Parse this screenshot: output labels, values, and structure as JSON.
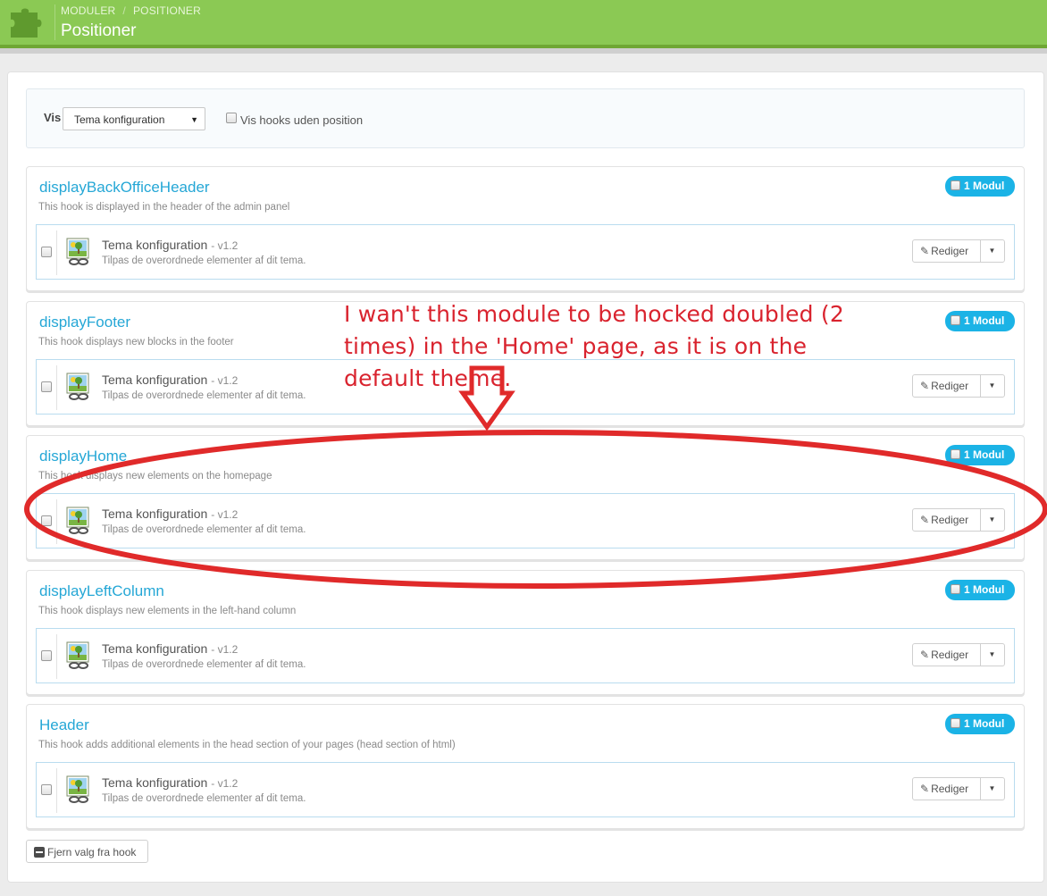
{
  "header": {
    "breadcrumb": [
      "MODULER",
      "POSITIONER"
    ],
    "title": "Positioner",
    "colors": {
      "bar": "#8bc954",
      "accent_line": "#6fa734"
    },
    "icon": "puzzle-piece-icon"
  },
  "filter": {
    "label": "Vis",
    "select_value": "Tema konfiguration",
    "checkbox_label": "Vis hooks uden position"
  },
  "hooks": [
    {
      "name": "displayBackOfficeHeader",
      "description": "This hook is displayed in the header of the admin panel",
      "badge": "1 Modul",
      "module": {
        "name": "Tema konfiguration",
        "version": "- v1.2",
        "description": "Tilpas de overordnede elementer af dit tema.",
        "edit_label": "Rediger"
      }
    },
    {
      "name": "displayFooter",
      "description": "This hook displays new blocks in the footer",
      "badge": "1 Modul",
      "module": {
        "name": "Tema konfiguration",
        "version": "- v1.2",
        "description": "Tilpas de overordnede elementer af dit tema.",
        "edit_label": "Rediger"
      }
    },
    {
      "name": "displayHome",
      "description": "This hook displays new elements on the homepage",
      "badge": "1 Modul",
      "module": {
        "name": "Tema konfiguration",
        "version": "- v1.2",
        "description": "Tilpas de overordnede elementer af dit tema.",
        "edit_label": "Rediger"
      }
    },
    {
      "name": "displayLeftColumn",
      "description": "This hook displays new elements in the left-hand column",
      "badge": "1 Modul",
      "module": {
        "name": "Tema konfiguration",
        "version": "- v1.2",
        "description": "Tilpas de overordnede elementer af dit tema.",
        "edit_label": "Rediger"
      }
    },
    {
      "name": "Header",
      "description": "This hook adds additional elements in the head section of your pages (head section of html)",
      "badge": "1 Modul",
      "module": {
        "name": "Tema konfiguration",
        "version": "- v1.2",
        "description": "Tilpas de overordnede elementer af dit tema.",
        "edit_label": "Rediger"
      }
    }
  ],
  "footer": {
    "remove_label": "Fjern valg fra hook"
  },
  "annotation": {
    "text": "I wan't this module to be hocked doubled (2 times) in the 'Home' page, as it is on the default theme.",
    "color": "#d9232e"
  },
  "colors": {
    "link": "#25a7d6",
    "badge": "#1bb3e6"
  }
}
